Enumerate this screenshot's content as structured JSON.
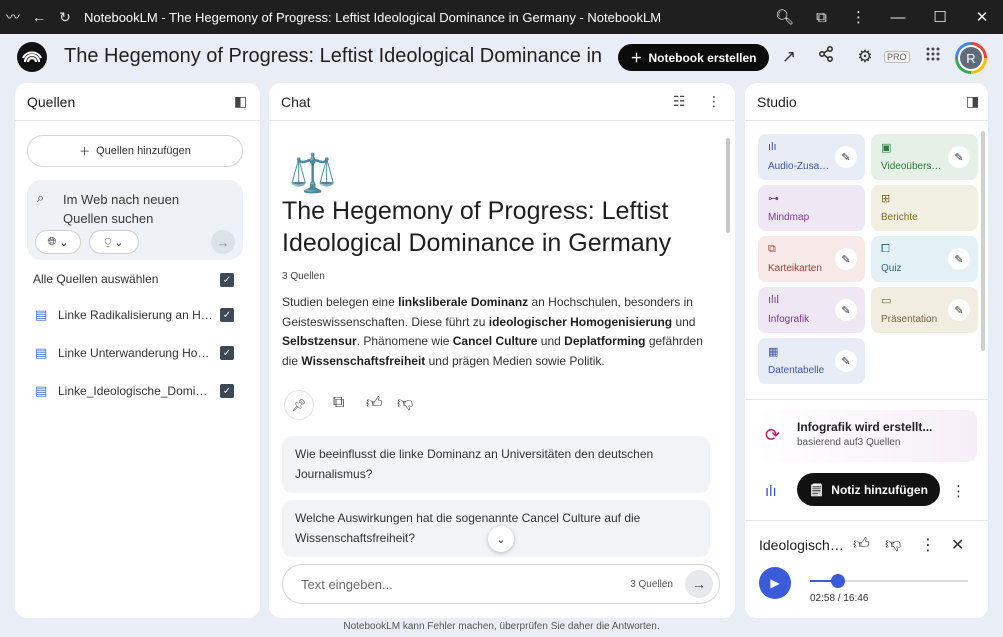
{
  "window": {
    "app_name": "NotebookLM",
    "title": "NotebookLM - The Hegemony of Progress: Leftist Ideological Dominance in Germany - NotebookLM"
  },
  "header": {
    "notebook_title": "The Hegemony of Progress: Leftist Ideological Dominance in Germany",
    "create_button": "Notebook erstellen",
    "pro_badge": "PRO",
    "avatar_letter": "R"
  },
  "sources": {
    "title": "Quellen",
    "add_button": "Quellen hinzufügen",
    "web_search_placeholder": "Im Web nach neuen Quellen suchen",
    "select_all_label": "Alle Quellen auswählen",
    "items": [
      {
        "label": "Linke Radikalisierung an Hochschulen",
        "checked": true
      },
      {
        "label": "Linke Unterwanderung Hochschulen",
        "checked": true
      },
      {
        "label": "Linke_Ideologische_Dominanz",
        "checked": true
      }
    ]
  },
  "chat": {
    "title": "Chat",
    "emoji": "⚖️",
    "notebook_title": "The Hegemony of Progress: Leftist Ideological Dominance in Germany",
    "source_count": "3 Quellen",
    "summary_parts": {
      "p1": "Studien belegen eine ",
      "b1": "linksliberale Dominanz",
      "p2": " an Hochschulen, besonders in Geisteswissenschaften. Diese führt zu ",
      "b2": "ideologischer Homogenisierung",
      "p3": " und ",
      "b3": "Selbstzensur",
      "p4": ". Phänomene wie ",
      "b4": "Cancel Culture",
      "p5": " und ",
      "b5": "Deplatforming",
      "p6": " gefährden die ",
      "b6": "Wissenschaftsfreiheit",
      "p7": " und prägen Medien sowie Politik."
    },
    "suggestions": [
      "Wie beeinflusst die linke Dominanz an Universitäten den deutschen Journalismus?",
      "Welche Auswirkungen hat die sogenannte Cancel Culture auf die Wissenschaftsfreiheit?"
    ],
    "input_placeholder": "Text eingeben...",
    "input_source_count": "3 Quellen"
  },
  "studio": {
    "title": "Studio",
    "tiles": [
      {
        "label": "Audio-Zusammenfassung",
        "icon": "audio-waveform-icon",
        "color": "#e8ecf7"
      },
      {
        "label": "Videoübersicht",
        "icon": "video-icon",
        "color": "#e5f1e6"
      },
      {
        "label": "Mindmap",
        "icon": "mindmap-icon",
        "color": "#efe8f4"
      },
      {
        "label": "Berichte",
        "icon": "report-icon",
        "color": "#f2f0e3"
      },
      {
        "label": "Karteikarten",
        "icon": "flashcards-icon",
        "color": "#f7e9e8"
      },
      {
        "label": "Quiz",
        "icon": "quiz-icon",
        "color": "#e3f1f7"
      },
      {
        "label": "Infografik",
        "icon": "infographic-icon",
        "color": "#efe8f4"
      },
      {
        "label": "Präsentation",
        "icon": "presentation-icon",
        "color": "#f2ede1"
      },
      {
        "label": "Datentabelle",
        "icon": "table-icon",
        "color": "#e8ecf7"
      }
    ],
    "generating": {
      "title": "Infografik wird erstellt...",
      "subtitle": "basierend auf3 Quellen"
    },
    "add_note_button": "Notiz hinzufügen",
    "player": {
      "title": "Ideologische Dominanz",
      "current_time": "02:58",
      "separator": " / ",
      "duration": "16:46",
      "progress": 0.177
    }
  },
  "footer": {
    "disclaimer": "NotebookLM kann Fehler machen, überprüfen Sie daher die Antworten."
  }
}
